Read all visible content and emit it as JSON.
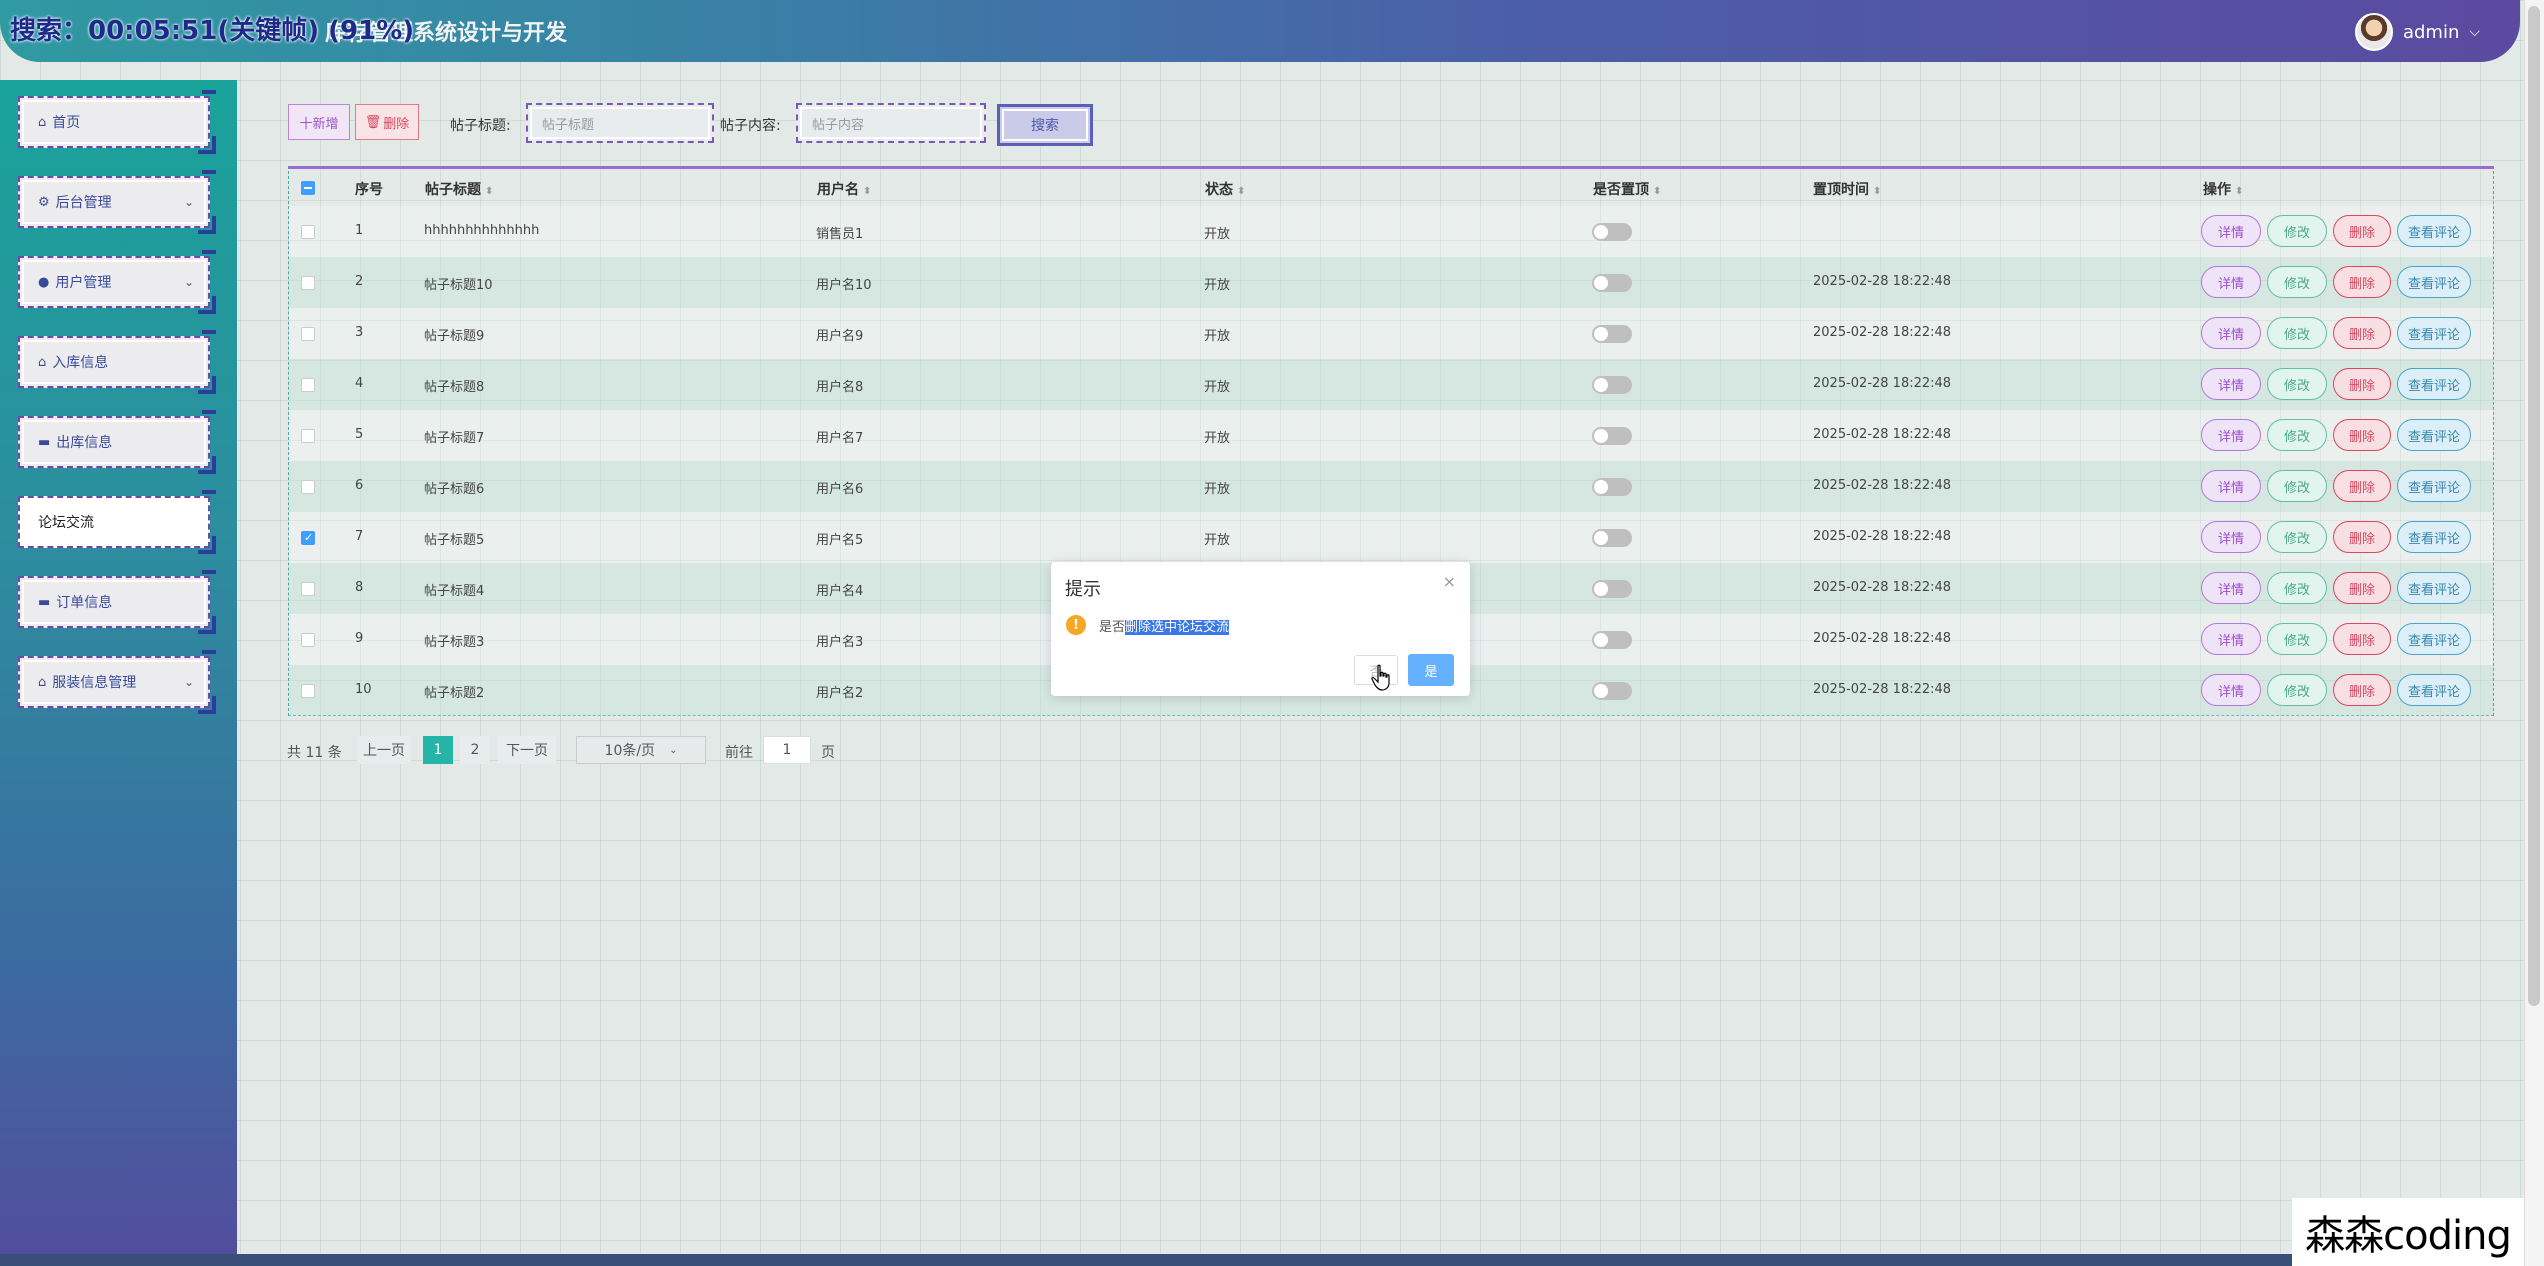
{
  "overlay": {
    "search_text": "搜索：00:05:51(关键帧) (91%)"
  },
  "header": {
    "title": "库存管理系统设计与开发",
    "username": "admin",
    "chevron": "⌵"
  },
  "sidebar": {
    "items": [
      {
        "label": "首页",
        "icon": "home-icon",
        "glyph": "⌂"
      },
      {
        "label": "后台管理",
        "icon": "settings-icon",
        "glyph": "⚙",
        "arrow": "⌄"
      },
      {
        "label": "用户管理",
        "icon": "user-icon",
        "glyph": "●",
        "arrow": "⌄"
      },
      {
        "label": "入库信息",
        "icon": "house-icon",
        "glyph": "⌂"
      },
      {
        "label": "出库信息",
        "icon": "card-icon",
        "glyph": "▬"
      },
      {
        "label": "论坛交流",
        "icon": "",
        "glyph": ""
      },
      {
        "label": "订单信息",
        "icon": "card-icon",
        "glyph": "▬"
      },
      {
        "label": "服装信息管理",
        "icon": "house-icon",
        "glyph": "⌂",
        "arrow": "⌄"
      }
    ],
    "active_index": 5
  },
  "toolbar": {
    "add_label": "十新增",
    "delete_label": "删除",
    "title_label": "帖子标题:",
    "title_placeholder": "帖子标题",
    "content_label": "帖子内容:",
    "content_placeholder": "帖子内容",
    "search_label": "搜索"
  },
  "table": {
    "columns": [
      "序号",
      "帖子标题",
      "用户名",
      "状态",
      "是否置顶",
      "置顶时间",
      "操作"
    ],
    "sort_glyph": "⬍",
    "rows": [
      {
        "no": "1",
        "title": "hhhhhhhhhhhhhh",
        "user": "销售员1",
        "status": "开放",
        "time": "",
        "checked": false
      },
      {
        "no": "2",
        "title": "帖子标题10",
        "user": "用户名10",
        "status": "开放",
        "time": "2025-02-28 18:22:48",
        "checked": false
      },
      {
        "no": "3",
        "title": "帖子标题9",
        "user": "用户名9",
        "status": "开放",
        "time": "2025-02-28 18:22:48",
        "checked": false
      },
      {
        "no": "4",
        "title": "帖子标题8",
        "user": "用户名8",
        "status": "开放",
        "time": "2025-02-28 18:22:48",
        "checked": false
      },
      {
        "no": "5",
        "title": "帖子标题7",
        "user": "用户名7",
        "status": "开放",
        "time": "2025-02-28 18:22:48",
        "checked": false
      },
      {
        "no": "6",
        "title": "帖子标题6",
        "user": "用户名6",
        "status": "开放",
        "time": "2025-02-28 18:22:48",
        "checked": false
      },
      {
        "no": "7",
        "title": "帖子标题5",
        "user": "用户名5",
        "status": "开放",
        "time": "2025-02-28 18:22:48",
        "checked": true
      },
      {
        "no": "8",
        "title": "帖子标题4",
        "user": "用户名4",
        "status": "",
        "time": "2025-02-28 18:22:48",
        "checked": false
      },
      {
        "no": "9",
        "title": "帖子标题3",
        "user": "用户名3",
        "status": "",
        "time": "2025-02-28 18:22:48",
        "checked": false
      },
      {
        "no": "10",
        "title": "帖子标题2",
        "user": "用户名2",
        "status": "",
        "time": "2025-02-28 18:22:48",
        "checked": false
      }
    ],
    "actions": {
      "detail": "详情",
      "edit": "修改",
      "delete": "删除",
      "comments": "查看评论"
    }
  },
  "pagination": {
    "total": "共 11 条",
    "prev": "上一页",
    "pages": [
      "1",
      "2"
    ],
    "current": "1",
    "next": "下一页",
    "page_size": "10条/页",
    "goto_label": "前往",
    "goto_value": "1",
    "page_suffix": "页"
  },
  "modal": {
    "title": "提示",
    "close": "×",
    "icon_glyph": "!",
    "msg_prefix": "是否",
    "msg_highlight": "删除选中论坛交流",
    "no_label": "否",
    "yes_label": "是"
  },
  "colors": {
    "accent": "#409eff",
    "header_start": "#2f9aa2",
    "header_end": "#5b4aa0",
    "sidebar_start": "#1aa39a",
    "sidebar_end": "#534d9e"
  },
  "watermark": "森森coding"
}
